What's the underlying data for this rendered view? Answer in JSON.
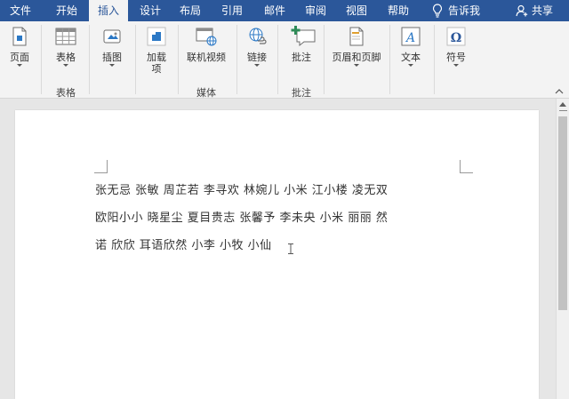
{
  "tabs": [
    {
      "id": "file",
      "label": "文件"
    },
    {
      "id": "home",
      "label": "开始"
    },
    {
      "id": "insert",
      "label": "插入",
      "active": true
    },
    {
      "id": "design",
      "label": "设计"
    },
    {
      "id": "layout",
      "label": "布局"
    },
    {
      "id": "references",
      "label": "引用"
    },
    {
      "id": "mailings",
      "label": "邮件"
    },
    {
      "id": "review",
      "label": "审阅"
    },
    {
      "id": "view",
      "label": "视图"
    },
    {
      "id": "help",
      "label": "帮助"
    }
  ],
  "tellme": {
    "label": "告诉我",
    "icon": "lightbulb-icon"
  },
  "share": {
    "label": "共享",
    "icon": "person-add-icon"
  },
  "ribbon": {
    "pages": {
      "label": "页面",
      "icon": "page-icon"
    },
    "table": {
      "label": "表格",
      "icon": "table-icon"
    },
    "illustrations": {
      "label": "插图",
      "icon": "illustrations-icon"
    },
    "addins": {
      "label1": "加载",
      "label2": "项",
      "icon": "addins-icon"
    },
    "online_video": {
      "label": "联机视频",
      "icon": "online-video-icon"
    },
    "link": {
      "label": "链接",
      "icon": "link-icon"
    },
    "comment": {
      "label": "批注",
      "icon": "comment-icon"
    },
    "header_footer": {
      "label": "页眉和页脚",
      "icon": "header-footer-icon"
    },
    "text": {
      "label": "文本",
      "icon": "text-box-icon"
    },
    "symbols": {
      "label": "符号",
      "icon": "omega-icon"
    },
    "groups": {
      "table": "表格",
      "media": "媒体",
      "comments": "批注"
    }
  },
  "document": {
    "names": "张无忌 张敏 周芷若 李寻欢 林婉儿 小米 江小楼 凌无双 欧阳小小 晓星尘 夏目贵志 张馨予 李未央 小米 丽丽 然诺 欣欣 耳语欣然 小李 小牧 小仙"
  },
  "colors": {
    "accent": "#2b579a",
    "ribbon_bg": "#f3f3f3",
    "canvas": "#e6e6e6"
  }
}
